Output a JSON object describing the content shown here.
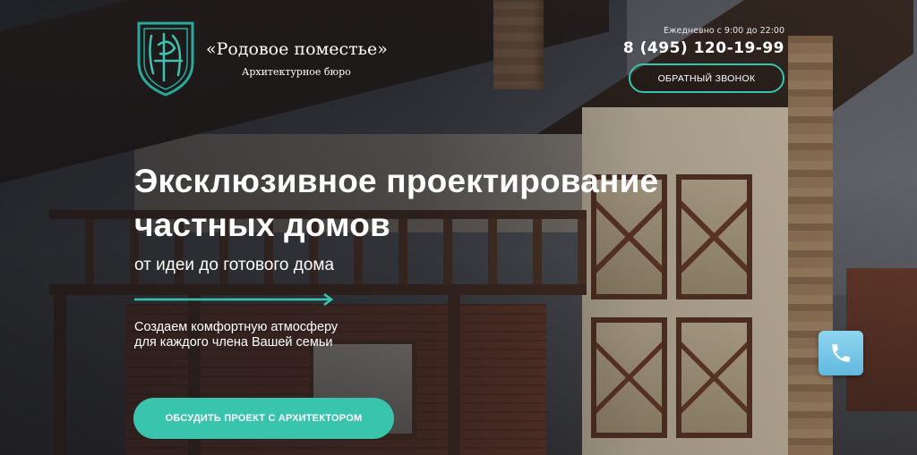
{
  "brand": {
    "name": "«Родовое поместье»",
    "subtitle": "Архитектурное бюро",
    "logo_icon": "monogram-shield-icon",
    "accent_color": "#39c4ae"
  },
  "contacts": {
    "hours": "Ежедневно с 9:00 до 22:00",
    "phone": "8 (495) 120-19-99",
    "callback_label": "ОБРАТНЫЙ ЗВОНОК"
  },
  "hero": {
    "headline_line1": "Эксклюзивное проектирование",
    "headline_line2": "частных домов",
    "subheadline": "от идеи до готового дома",
    "description_line1": "Создаем комфортную атмосферу",
    "description_line2": "для каждого члена Вашей семьи",
    "cta_label": "ОБСУДИТЬ ПРОЕКТ С АРХИТЕКТОРОМ"
  },
  "floating_button": {
    "icon": "phone-icon",
    "color": "#6cc0e5"
  }
}
